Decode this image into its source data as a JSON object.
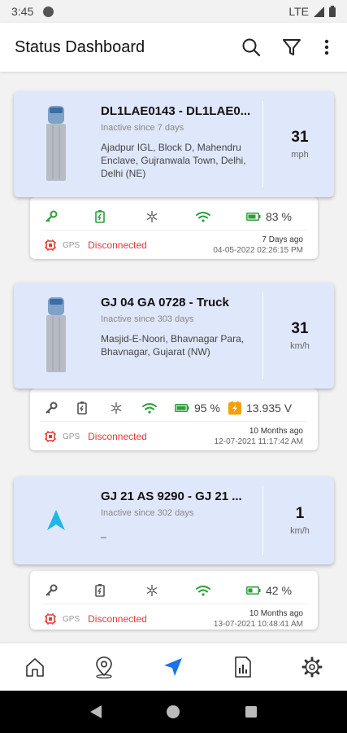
{
  "status_bar": {
    "time": "3:45",
    "network": "LTE"
  },
  "header": {
    "title": "Status Dashboard"
  },
  "vehicles": [
    {
      "title": "DL1LAE0143 - DL1LAE0...",
      "inactive": "Inactive since 7 days",
      "address": "Ajadpur IGL, Block D, Mahendru Enclave, Gujranwala Town, Delhi, Delhi (NE)",
      "speed": "31",
      "unit": "mph",
      "battery": "83 %",
      "gps_label": "GPS",
      "status": "Disconnected",
      "ago": "7 Days ago",
      "datetime": "04-05-2022 02:26:15 PM"
    },
    {
      "title": "GJ 04 GA 0728 - Truck",
      "inactive": "Inactive since 303 days",
      "address": "Masjid-E-Noori, Bhavnagar Para, Bhavnagar, Gujarat (NW)",
      "speed": "31",
      "unit": "km/h",
      "battery": "95 %",
      "voltage": "13.935 V",
      "gps_label": "GPS",
      "status": "Disconnected",
      "ago": "10 Months ago",
      "datetime": "12-07-2021 11:17:42 AM"
    },
    {
      "title": "GJ 21 AS 9290 - GJ 21 ...",
      "inactive": "Inactive since 302 days",
      "address": "_",
      "speed": "1",
      "unit": "km/h",
      "battery": "42 %",
      "gps_label": "GPS",
      "status": "Disconnected",
      "ago": "10 Months ago",
      "datetime": "13-07-2021 10:48:41 AM"
    }
  ],
  "colors": {
    "card_bg": "#dfe7fb",
    "green": "#2e9e3a",
    "red": "#e53935",
    "orange": "#f59f00",
    "nav_active": "#1a73e8"
  }
}
